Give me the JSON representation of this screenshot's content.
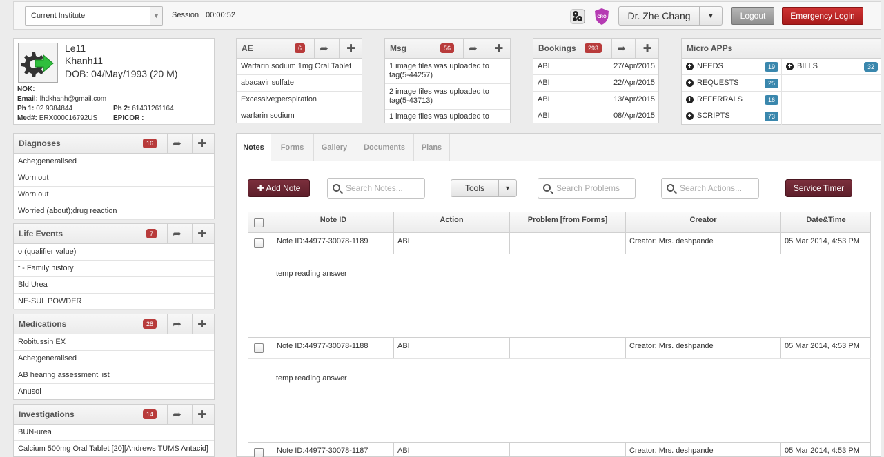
{
  "topbar": {
    "institute": "Current Institute",
    "session_label": "Session",
    "session_time": "00:00:52",
    "cro_label": "CRO",
    "doctor": "Dr. Zhe Chang",
    "logout": "Logout",
    "emergency": "Emergency Login"
  },
  "patient": {
    "first_name": "Le11",
    "last_name": "Khanh11",
    "dob": "DOB: 04/May/1993 (20 M)",
    "nok_label": "NOK:",
    "email_label": "Email:",
    "email": "lhdkhanh@gmail.com",
    "ph1_label": "Ph 1:",
    "ph1": "02 9384844",
    "ph2_label": "Ph 2:",
    "ph2": "61431261164",
    "med_label": "Med#:",
    "med": "ERX000016792US",
    "epicor_label": "EPICOR :"
  },
  "diagnoses": {
    "title": "Diagnoses",
    "count": "16",
    "items": [
      "Ache;generalised",
      "Worn out",
      "Worn out",
      "Worried (about);drug reaction"
    ]
  },
  "life_events": {
    "title": "Life Events",
    "count": "7",
    "items": [
      "o (qualifier value)",
      "f - Family history",
      "Bld Urea",
      "NE-SUL POWDER"
    ]
  },
  "medications": {
    "title": "Medications",
    "count": "28",
    "items": [
      "Robitussin EX",
      "Ache;generalised",
      "AB hearing assessment list",
      "Anusol"
    ]
  },
  "investigations": {
    "title": "Investigations",
    "count": "14",
    "items": [
      "BUN-urea",
      "Calcium 500mg Oral Tablet [20][Andrews TUMS Antacid]"
    ]
  },
  "ae": {
    "title": "AE",
    "count": "6",
    "items": [
      "Warfarin sodium 1mg Oral Tablet",
      "abacavir sulfate",
      "Excessive;perspiration",
      "warfarin sodium"
    ]
  },
  "msg": {
    "title": "Msg",
    "count": "56",
    "items": [
      "1 image files was uploaded to tag(5-44257)",
      "2 image files was uploaded to tag(5-43713)",
      "1 image files was uploaded to"
    ]
  },
  "bookings": {
    "title": "Bookings",
    "count": "293",
    "items": [
      {
        "name": "ABI",
        "date": "27/Apr/2015"
      },
      {
        "name": "ABI",
        "date": "22/Apr/2015"
      },
      {
        "name": "ABI",
        "date": "13/Apr/2015"
      },
      {
        "name": "ABI",
        "date": "08/Apr/2015"
      }
    ]
  },
  "micro_apps": {
    "title": "Micro APPs",
    "items": [
      {
        "label": "NEEDS",
        "count": "19"
      },
      {
        "label": "BILLS",
        "count": "32"
      },
      {
        "label": "REQUESTS",
        "count": "25"
      },
      {
        "label": "",
        "count": ""
      },
      {
        "label": "REFERRALS",
        "count": "16"
      },
      {
        "label": "",
        "count": ""
      },
      {
        "label": "SCRIPTS",
        "count": "73"
      },
      {
        "label": "",
        "count": ""
      }
    ]
  },
  "main": {
    "tabs": [
      "Notes",
      "Forms",
      "Gallery",
      "Documents",
      "Plans"
    ],
    "add_note": "Add Note",
    "search_notes": "Search Notes...",
    "tools": "Tools",
    "search_problems": "Search Problems",
    "search_actions": "Search Actions...",
    "service_timer": "Service Timer",
    "columns": [
      "Note ID",
      "Action",
      "Problem [from Forms]",
      "Creator",
      "Date&Time"
    ],
    "notes": [
      {
        "id": "Note ID:44977-30078-1189",
        "action": "ABI",
        "problem": "",
        "creator": "Creator: Mrs. deshpande",
        "datetime": "05 Mar 2014, 4:53 PM",
        "body": "temp reading answer"
      },
      {
        "id": "Note ID:44977-30078-1188",
        "action": "ABI",
        "problem": "",
        "creator": "Creator: Mrs. deshpande",
        "datetime": "05 Mar 2014, 4:53 PM",
        "body": "temp reading answer"
      },
      {
        "id": "Note ID:44977-30078-1187",
        "action": "ABI",
        "problem": "",
        "creator": "Creator: Mrs. deshpande",
        "datetime": "05 Mar 2014, 4:53 PM",
        "body": ""
      }
    ]
  }
}
